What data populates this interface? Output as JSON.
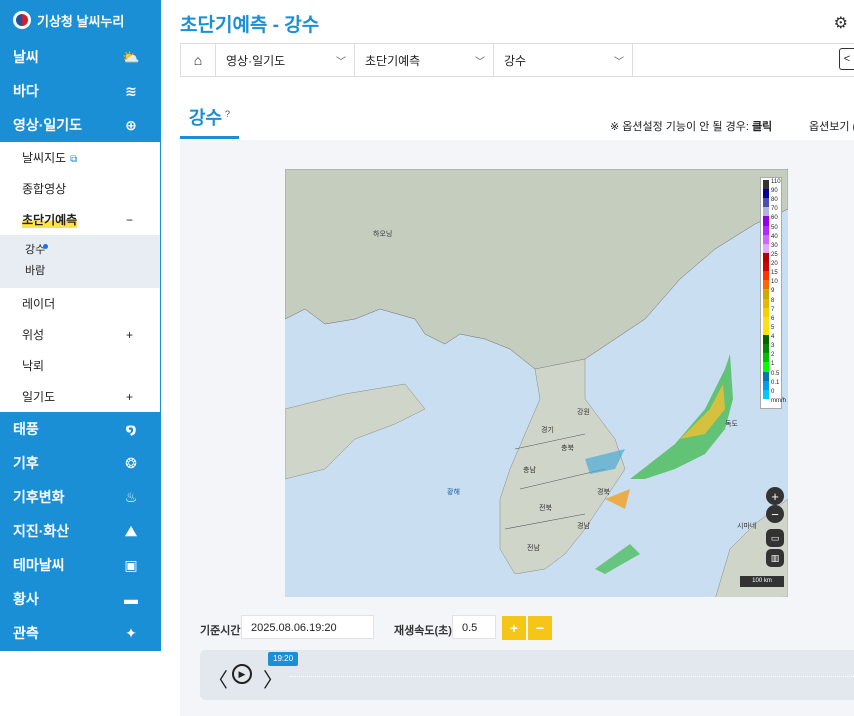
{
  "sidebar": {
    "logo_text": "기상청 날씨누리",
    "items": [
      {
        "label": "날씨",
        "icon": "cloud-sun-icon"
      },
      {
        "label": "바다",
        "icon": "wave-icon"
      },
      {
        "label": "영상·일기도",
        "icon": "globe-icon"
      }
    ],
    "sub_items": [
      {
        "label": "날씨지도",
        "icon": "external-link-icon"
      },
      {
        "label": "종합영상"
      },
      {
        "label": "초단기예측",
        "toggle": "−"
      },
      {
        "label": "레이더"
      },
      {
        "label": "위성",
        "toggle": "+"
      },
      {
        "label": "낙뢰"
      },
      {
        "label": "일기도",
        "toggle": "+"
      }
    ],
    "third_items": [
      {
        "label": "강수"
      },
      {
        "label": "바람"
      }
    ],
    "bottom_items": [
      {
        "label": "태풍",
        "icon": "typhoon-icon"
      },
      {
        "label": "기후",
        "icon": "climate-icon"
      },
      {
        "label": "기후변화",
        "icon": "climate-change-icon"
      },
      {
        "label": "지진·화산",
        "icon": "volcano-icon"
      },
      {
        "label": "테마날씨",
        "icon": "suitcase-icon"
      },
      {
        "label": "황사",
        "icon": "dust-icon"
      },
      {
        "label": "관측",
        "icon": "observe-icon"
      }
    ]
  },
  "header": {
    "title": "초단기예측 - 강수",
    "settings_icon": "gear-icon"
  },
  "breadcrumb": {
    "home_icon": "home-icon",
    "items": [
      "영상·일기도",
      "초단기예측",
      "강수"
    ]
  },
  "tab": {
    "label": "강수",
    "help": "?"
  },
  "notice": {
    "prefix": "※ 옵션설정 기능이 안 될 경우:",
    "link": "클릭"
  },
  "option_label": "옵션보기 (",
  "map": {
    "labels": [
      "하오닝",
      "강원",
      "경기",
      "충북",
      "충남",
      "전북",
      "경북",
      "경남",
      "전남",
      "독도",
      "시마네",
      "황해"
    ],
    "legend_values": [
      "110",
      "90",
      "80",
      "70",
      "60",
      "50",
      "40",
      "30",
      "25",
      "20",
      "15",
      "10",
      "9",
      "8",
      "7",
      "6",
      "5",
      "4",
      "3",
      "2",
      "1",
      "0.5",
      "0.1",
      "0",
      "mm/h"
    ],
    "legend_colors": [
      "#333333",
      "#000390",
      "#4c4eb1",
      "#b3b4de",
      "#9300e4",
      "#b329ff",
      "#c969ff",
      "#e0a9ff",
      "#b40000",
      "#d20000",
      "#ff3200",
      "#ff6600",
      "#ccaa00",
      "#e0b900",
      "#f9cd00",
      "#ffdc1f",
      "#ffe100",
      "#006600",
      "#008800",
      "#00be00",
      "#00ff00",
      "#0077b3",
      "#009bf5",
      "#00c8ff",
      "#ffffff"
    ],
    "scale_label": "100 km",
    "zoom_in": "+",
    "zoom_out": "−"
  },
  "controls": {
    "time_label": "기준시간",
    "time_value": "2025.08.06.19:20",
    "speed_label": "재생속도(초)",
    "speed_value": "0.5",
    "plus": "+",
    "minus": "−",
    "current_time_badge": "19:20",
    "prev": "〈",
    "next": "〉",
    "play": "▶"
  }
}
